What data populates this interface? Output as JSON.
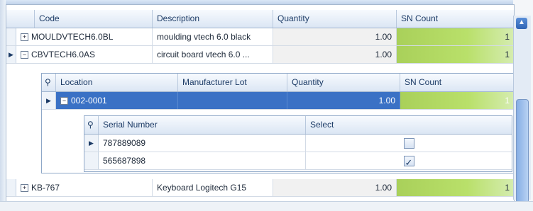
{
  "main_grid": {
    "headers": [
      "Code",
      "Description",
      "Quantity",
      "SN Count"
    ],
    "rows": [
      {
        "code": "MOULDVTECH6.0BL",
        "description": "moulding vtech 6.0 black",
        "quantity": "1.00",
        "sn_count": "1"
      },
      {
        "code": "CBVTECH6.0AS",
        "description": "circuit board vtech 6.0 ...",
        "quantity": "1.00",
        "sn_count": "1"
      },
      {
        "code": "KB-767",
        "description": "Keyboard Logitech G15",
        "quantity": "1.00",
        "sn_count": "1"
      }
    ]
  },
  "location_grid": {
    "headers": [
      "Location",
      "Manufacturer Lot",
      "Quantity",
      "SN Count"
    ],
    "row": {
      "location": "002-0001",
      "manufacturer_lot": "",
      "quantity": "1.00",
      "sn_count": "1"
    }
  },
  "serial_grid": {
    "headers": [
      "Serial Number",
      "Select"
    ],
    "rows": [
      {
        "serial": "787889089",
        "selected": false
      },
      {
        "serial": "565687898",
        "selected": true
      }
    ]
  },
  "icons": {
    "expand": "plus-box-icon",
    "collapse": "minus-box-icon",
    "search": "search-icon",
    "row_indicator": "triangle-right-icon",
    "scroll_up": "chevron-up-icon"
  }
}
